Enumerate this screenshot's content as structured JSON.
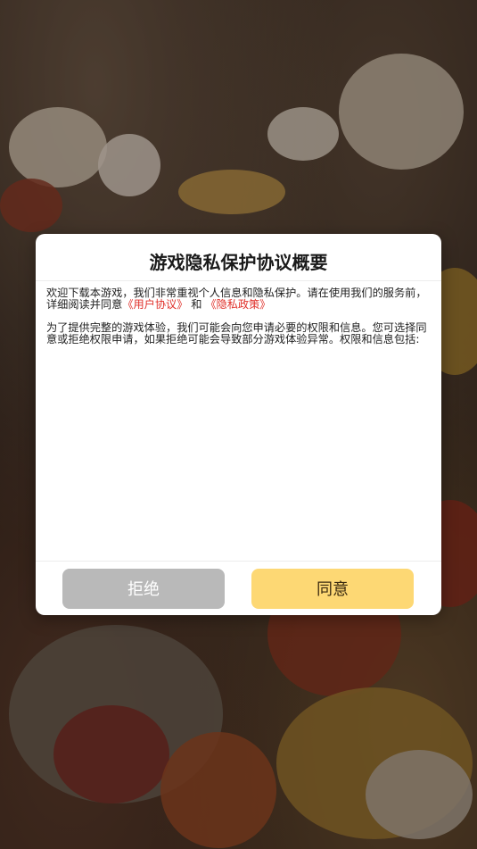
{
  "dialog": {
    "title": "游戏隐私保护协议概要",
    "para1_prefix": "欢迎下载本游戏，我们非常重视个人信息和隐私保护。请在使用我们的服务前，详细阅读并同意",
    "user_agreement_link": "《用户协议》",
    "conjunction": " 和 ",
    "privacy_policy_link": "《隐私政策》",
    "para2": "为了提供完整的游戏体验，我们可能会向您申请必要的权限和信息。您可选择同意或拒绝权限申请，如果拒绝可能会导致部分游戏体验异常。权限和信息包括:",
    "reject_label": "拒绝",
    "accept_label": "同意"
  },
  "colors": {
    "link": "#e0302a",
    "reject_button": "#b9b9b9",
    "accept_button": "#fdd874"
  }
}
